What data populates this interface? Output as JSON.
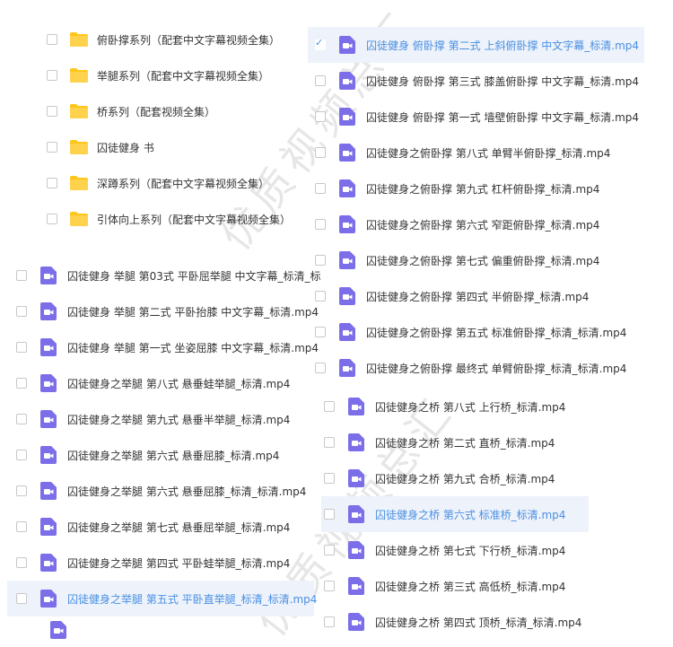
{
  "folders": [
    {
      "name": "俯卧撑系列（配套中文字幕视频全集）"
    },
    {
      "name": "举腿系列（配套中文字幕视频全集）"
    },
    {
      "name": "桥系列（配套视频全集）"
    },
    {
      "name": "囚徒健身  书"
    },
    {
      "name": "深蹲系列（配套中文字幕视频全集）"
    },
    {
      "name": "引体向上系列（配套中文字幕视频全集）"
    }
  ],
  "left_files": [
    {
      "name": "囚徒健身 举腿 第03式 平卧屈举腿 中文字幕_标清_标",
      "selected": false
    },
    {
      "name": "囚徒健身 举腿 第二式 平卧抬膝 中文字幕_标清.mp4",
      "selected": false
    },
    {
      "name": "囚徒健身 举腿 第一式 坐姿屈膝 中文字幕_标清.mp4",
      "selected": false
    },
    {
      "name": "囚徒健身之举腿 第八式 悬垂蛙举腿_标清.mp4",
      "selected": false
    },
    {
      "name": "囚徒健身之举腿 第九式 悬垂半举腿_标清.mp4",
      "selected": false
    },
    {
      "name": "囚徒健身之举腿 第六式 悬垂屈膝_标清.mp4",
      "selected": false
    },
    {
      "name": "囚徒健身之举腿 第六式 悬垂屈膝_标清_标清.mp4",
      "selected": false
    },
    {
      "name": "囚徒健身之举腿 第七式 悬垂屈举腿_标清.mp4",
      "selected": false
    },
    {
      "name": "囚徒健身之举腿 第四式 平卧蛙举腿_标清.mp4",
      "selected": false
    },
    {
      "name": "囚徒健身之举腿 第五式 平卧直举腿_标清_标清.mp4",
      "selected": true
    }
  ],
  "right_files_pushup": [
    {
      "name": "囚徒健身 俯卧撑 第二式 上斜俯卧撑 中文字幕_标清.mp4",
      "selected": true
    },
    {
      "name": "囚徒健身 俯卧撑 第三式 膝盖俯卧撑 中文字幕_标清.mp4",
      "selected": false
    },
    {
      "name": "囚徒健身 俯卧撑 第一式 墙壁俯卧撑 中文字幕_标清.mp4",
      "selected": false
    },
    {
      "name": "囚徒健身之俯卧撑 第八式 单臂半俯卧撑_标清.mp4",
      "selected": false
    },
    {
      "name": "囚徒健身之俯卧撑 第九式 杠杆俯卧撑_标清.mp4",
      "selected": false
    },
    {
      "name": "囚徒健身之俯卧撑 第六式 窄距俯卧撑_标清.mp4",
      "selected": false
    },
    {
      "name": "囚徒健身之俯卧撑 第七式 偏重俯卧撑_标清.mp4",
      "selected": false
    },
    {
      "name": "囚徒健身之俯卧撑 第四式 半俯卧撑_标清.mp4",
      "selected": false
    },
    {
      "name": "囚徒健身之俯卧撑 第五式 标准俯卧撑_标清_标清.mp4",
      "selected": false
    },
    {
      "name": "囚徒健身之俯卧撑 最终式 单臂俯卧撑_标清_标清.mp4",
      "selected": false
    }
  ],
  "right_files_bridge": [
    {
      "name": "囚徒健身之桥 第八式 上行桥_标清.mp4",
      "selected": false
    },
    {
      "name": "囚徒健身之桥 第二式 直桥_标清.mp4",
      "selected": false
    },
    {
      "name": "囚徒健身之桥 第九式 合桥_标清.mp4",
      "selected": false
    },
    {
      "name": "囚徒健身之桥 第六式 标准桥_标清.mp4",
      "selected": true
    },
    {
      "name": "囚徒健身之桥 第七式 下行桥_标清.mp4",
      "selected": false
    },
    {
      "name": "囚徒健身之桥 第三式 高低桥_标清.mp4",
      "selected": false
    },
    {
      "name": "囚徒健身之桥 第四式 顶桥_标清_标清.mp4",
      "selected": false
    }
  ],
  "watermark": {
    "top": "优质视频总汇",
    "bottom": "优质视频总汇"
  },
  "colors": {
    "folder": "#ffc61a",
    "video_icon": "#7b6ee8",
    "accent": "#4a90e2",
    "selection_bg": "#edf2fb"
  }
}
